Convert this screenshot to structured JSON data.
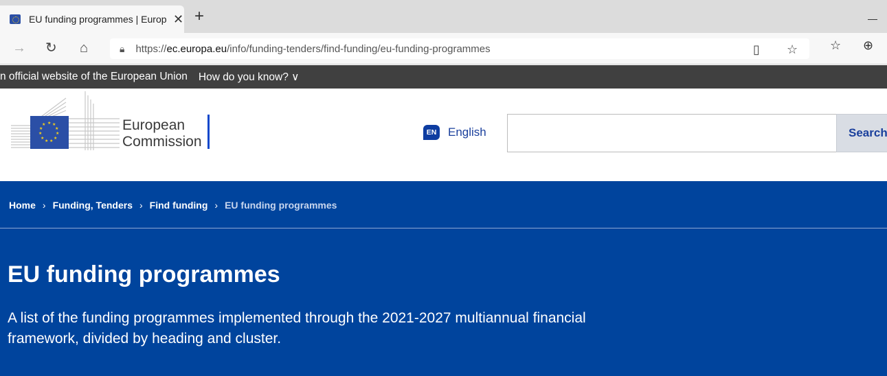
{
  "browser": {
    "tab_title": "EU funding programmes | Europ",
    "tab_close": "✕",
    "new_tab": "+",
    "url_prefix": "https://",
    "url_domain": "ec.europa.eu",
    "url_path": "/info/funding-tenders/find-funding/eu-funding-programmes"
  },
  "eu_banner": {
    "text": "n official website of the European Union",
    "how_know": "How do you know? ∨"
  },
  "header": {
    "logo_line1": "European",
    "logo_line2": "Commission",
    "lang_code": "EN",
    "lang_label": "English",
    "search_placeholder": "",
    "search_button": "Search"
  },
  "breadcrumb": {
    "items": [
      "Home",
      "Funding, Tenders",
      "Find funding"
    ],
    "current": "EU funding programmes",
    "separator": "›"
  },
  "hero": {
    "title": "EU funding programmes",
    "description": "A list of the funding programmes implemented through the 2021-2027 multiannual financial framework, divided by heading and cluster."
  },
  "colors": {
    "hero_blue": "#00449d",
    "banner_grey": "#404040",
    "link_blue": "#1a3f9c"
  }
}
